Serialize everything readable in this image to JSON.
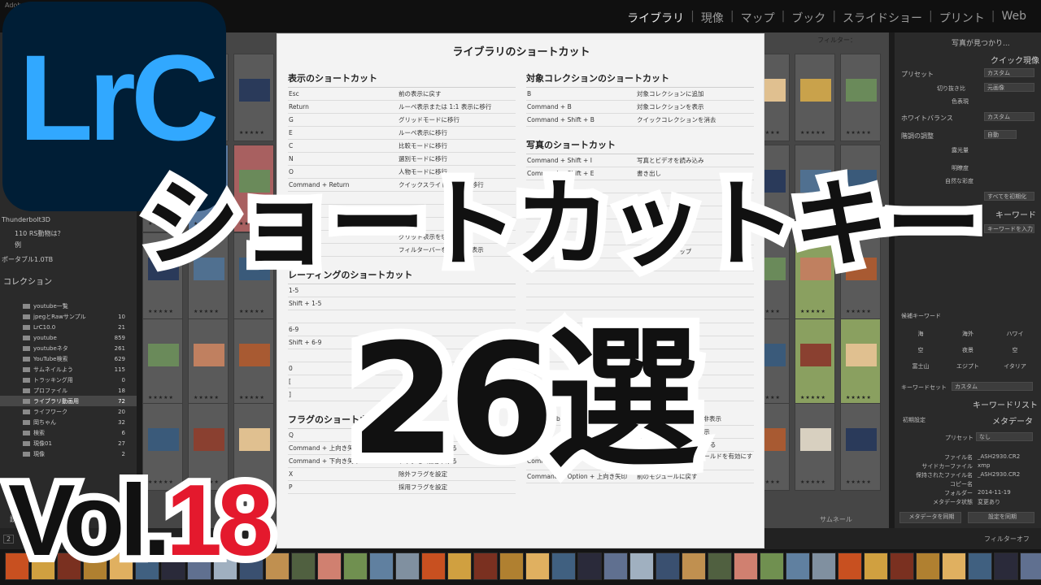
{
  "window": {
    "title": "Adobe Lightroom Classic"
  },
  "modules": [
    "ライブラリ",
    "現像",
    "マップ",
    "ブック",
    "スライドショー",
    "プリント",
    "Web"
  ],
  "left_panel": {
    "volume_label": "Thunderbolt3D",
    "folders": [
      "110 RS動物は？",
      "例"
    ],
    "portable": "ポータブル1.0TB",
    "collections_header": "コレクション",
    "collections": [
      {
        "name": "youtube一覧",
        "count": ""
      },
      {
        "name": "jpegとRawサンプル",
        "count": "10"
      },
      {
        "name": "LrC10.0",
        "count": "21"
      },
      {
        "name": "youtube",
        "count": "859"
      },
      {
        "name": "youtubeネタ",
        "count": "261"
      },
      {
        "name": "YouTube検索",
        "count": "629"
      },
      {
        "name": "サムネイルよう",
        "count": "115"
      },
      {
        "name": "トラッキング用",
        "count": "0"
      },
      {
        "name": "プロファイル",
        "count": "18"
      },
      {
        "name": "ライブラリ動画用",
        "count": "72"
      },
      {
        "name": "ライフワーク",
        "count": "20"
      },
      {
        "name": "岡ちゃん",
        "count": "32"
      },
      {
        "name": "検索",
        "count": "6"
      },
      {
        "name": "現像01",
        "count": "27"
      },
      {
        "name": "現像",
        "count": "2"
      }
    ],
    "import_label": "読み込み..."
  },
  "grid": {
    "filter_label": "フィルター："
  },
  "right_panel": {
    "no_photo": "写真が見つかり...",
    "quick_develop": "クイック現像",
    "preset_label": "プリセット",
    "preset_value": "カスタム",
    "crop_label": "切り抜き比",
    "crop_value": "元画像",
    "treatment_label": "色表現",
    "wb_label": "ホワイトバランス",
    "wb_value": "カスタム",
    "tone_label": "階調の調整",
    "tone_value": "自動",
    "exposure_label": "露光量",
    "clarity_label": "明瞭度",
    "vibrance_label": "自然な彩度",
    "reset_all": "すべてを初期化",
    "keywords_header": "キーワード",
    "keyword_input": "キーワードを入力",
    "suggestions_header": "候補キーワード",
    "suggestions": [
      "海",
      "海外",
      "ハワイ",
      "空",
      "夜景",
      "空",
      "富士山",
      "エジプト",
      "イタリア"
    ],
    "keyword_set_label": "キーワードセット",
    "keyword_set_value": "カスタム",
    "keyword_list": "キーワードリスト",
    "metadata_preset": "初期設定",
    "metadata_header": "メタデータ",
    "meta_preset_label": "プリセット",
    "meta_preset_value": "なし",
    "meta_rows": [
      {
        "k": "ファイル名",
        "v": "_ASH2930.CR2"
      },
      {
        "k": "サイドカーファイル",
        "v": "xmp"
      },
      {
        "k": "保持されたファイル名",
        "v": "_ASH2930.CR2"
      },
      {
        "k": "コピー名",
        "v": ""
      },
      {
        "k": "フォルダー",
        "v": "2014-11-19"
      },
      {
        "k": "メタデータ状態",
        "v": "変更あり"
      }
    ],
    "sync_metadata": "メタデータを同期",
    "sync_settings": "設定を同期"
  },
  "toolbar": {
    "thumb_label": "サムネール",
    "filter_off": "フィルターオフ",
    "page": "2"
  },
  "dialog": {
    "title": "ライブラリのショートカット",
    "left_sections": [
      {
        "heading": "表示のショートカット",
        "rows": [
          {
            "k": "Esc",
            "d": "前の表示に戻す"
          },
          {
            "k": "Return",
            "d": "ルーペ表示または 1:1 表示に移行"
          },
          {
            "k": "G",
            "d": "グリッドモードに移行"
          },
          {
            "k": "E",
            "d": "ルーペ表示に移行"
          },
          {
            "k": "C",
            "d": "比較モードに移行"
          },
          {
            "k": "N",
            "d": "選別モードに移行"
          },
          {
            "k": "O",
            "d": "人物モードに移行"
          },
          {
            "k": "Command + Return",
            "d": "クイックスライドショーへ移行"
          },
          {
            "k": "",
            "d": ""
          },
          {
            "k": "",
            "d": ""
          },
          {
            "k": "",
            "d": ""
          },
          {
            "k": "",
            "d": "グリッド表示を切り替え"
          },
          {
            "k": "",
            "d": "フィルターバーを表示 / 非表示"
          }
        ]
      },
      {
        "heading": "レーティングのショートカット",
        "rows": [
          {
            "k": "1-5",
            "d": ""
          },
          {
            "k": "Shift + 1-5",
            "d": ""
          },
          {
            "k": "",
            "d": ""
          },
          {
            "k": "6-9",
            "d": ""
          },
          {
            "k": "Shift + 6-9",
            "d": ""
          },
          {
            "k": "",
            "d": ""
          },
          {
            "k": "0",
            "d": ""
          },
          {
            "k": "[",
            "d": ""
          },
          {
            "k": "]",
            "d": ""
          }
        ]
      },
      {
        "heading": "フラグのショートカット",
        "rows": [
          {
            "k": "Q",
            "d": ""
          },
          {
            "k": "Command + 上向き矢印",
            "d": "フラグを1段階上げる"
          },
          {
            "k": "Command + 下向き矢印",
            "d": "フラグを1段階下げる"
          },
          {
            "k": "X",
            "d": "除外フラグを設定"
          },
          {
            "k": "P",
            "d": "採用フラグを設定"
          }
        ]
      }
    ],
    "right_sections": [
      {
        "heading": "対象コレクションのショートカット",
        "rows": [
          {
            "k": "B",
            "d": "対象コレクションに追加"
          },
          {
            "k": "Command + B",
            "d": "対象コレクションを表示"
          },
          {
            "k": "Command + Shift + B",
            "d": "クイックコレクションを消去"
          }
        ]
      },
      {
        "heading": "写真のショートカット",
        "rows": [
          {
            "k": "Command + Shift + I",
            "d": "写真とビデオを読み込み"
          },
          {
            "k": "Command + Shift + E",
            "d": "書き出し"
          },
          {
            "k": "",
            "d": ""
          },
          {
            "k": "",
            "d": ""
          },
          {
            "k": "",
            "d": ""
          },
          {
            "k": "",
            "d": ""
          },
          {
            "k": "",
            "d": ""
          },
          {
            "k": "",
            "d": "フィルムストリップ"
          },
          {
            "k": "",
            "d": "スタック"
          },
          {
            "k": "",
            "d": ""
          },
          {
            "k": "",
            "d": ""
          },
          {
            "k": "",
            "d": ""
          },
          {
            "k": "",
            "d": ""
          },
          {
            "k": "",
            "d": ""
          },
          {
            "k": "",
            "d": ""
          },
          {
            "k": "",
            "d": ""
          },
          {
            "k": "",
            "d": ""
          },
          {
            "k": "",
            "d": ""
          },
          {
            "k": "",
            "d": ""
          }
        ]
      },
      {
        "heading": "",
        "rows": [
          {
            "k": "Shift + Tab",
            "d": "すべてのパネルを表示 / 非表示"
          },
          {
            "k": "T",
            "d": "ツールバーを表示 / 非表示"
          },
          {
            "k": "Command + F",
            "d": "検索フィールドを有効にする"
          },
          {
            "k": "Command + K",
            "d": "キーワードエントリフィールドを有効にする"
          },
          {
            "k": "Command + Option + 上向き矢印",
            "d": "前のモジュールに戻す"
          }
        ]
      }
    ]
  },
  "overlay": {
    "logo": "LrC",
    "title": "ショートカットキー",
    "count": "26選",
    "vol_prefix": "Vol.",
    "vol_number": "18"
  },
  "colors": {
    "logo_bg": "#001e36",
    "logo_text": "#31a8ff",
    "vol_number": "#e4192d",
    "outline": "#ffffff"
  }
}
